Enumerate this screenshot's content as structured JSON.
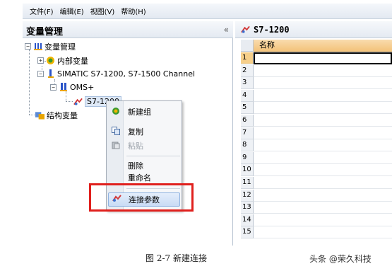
{
  "menu": {
    "items": [
      "文件(F)",
      "编辑(E)",
      "视图(V)",
      "帮助(H)"
    ]
  },
  "left_pane": {
    "title": "变量管理",
    "collapse_glyph": "«",
    "tree": {
      "root": "变量管理",
      "internal_vars": "内部变量",
      "channel": "SIMATIC S7-1200, S7-1500 Channel",
      "device": "OMS+",
      "connection": "S7-1200",
      "struct_vars": "结构变量"
    }
  },
  "context_menu": {
    "items": [
      {
        "label": "新建组",
        "icon": "new-group-icon"
      },
      {
        "label": "复制",
        "icon": "copy-icon"
      },
      {
        "label": "粘贴",
        "icon": "paste-icon",
        "disabled": true
      },
      {
        "label": "删除"
      },
      {
        "label": "重命名"
      },
      {
        "label": "连接参数",
        "icon": "connection-params-icon",
        "highlighted": true
      }
    ]
  },
  "right_pane": {
    "title": "S7-1200",
    "column_header": "名称",
    "row_numbers": [
      "1",
      "2",
      "3",
      "4",
      "5",
      "6",
      "7",
      "8",
      "9",
      "10",
      "11",
      "12",
      "13",
      "14",
      "15"
    ]
  },
  "caption": "图 2-7  新建连接",
  "watermark": "头条 @荣久科技",
  "colors": {
    "highlight_border": "#e0201d",
    "column_header": "#f3c37b"
  }
}
